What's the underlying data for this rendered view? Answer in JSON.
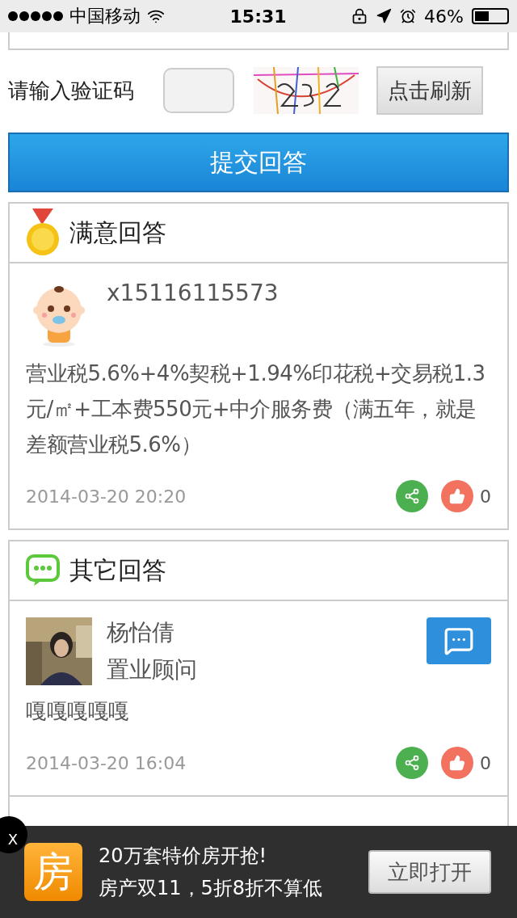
{
  "status_bar": {
    "carrier": "中国移动",
    "time": "15:31",
    "battery": "46%"
  },
  "captcha": {
    "label": "请输入验证码",
    "refresh_button": "点击刷新"
  },
  "submit_button": "提交回答",
  "best_answer": {
    "title": "满意回答",
    "user": "x15116115573",
    "text": "营业税5.6%+4%契税+1.94%印花税+交易税1.3元/㎡+工本费550元+中介服务费（满五年，就是差额营业税5.6%）",
    "time": "2014-03-20 20:20",
    "likes": "0"
  },
  "other_answers": {
    "title": "其它回答",
    "answers": [
      {
        "user": "杨怡倩",
        "role": "置业顾问",
        "text": "嘎嘎嘎嘎嘎",
        "time": "2014-03-20 16:04",
        "likes": "0",
        "chat": true
      }
    ]
  },
  "ad": {
    "close": "X",
    "logo": "房",
    "title": "20万套特价房开抢!",
    "subtitle": "房产双11，5折8折不算低",
    "button": "立即打开"
  }
}
